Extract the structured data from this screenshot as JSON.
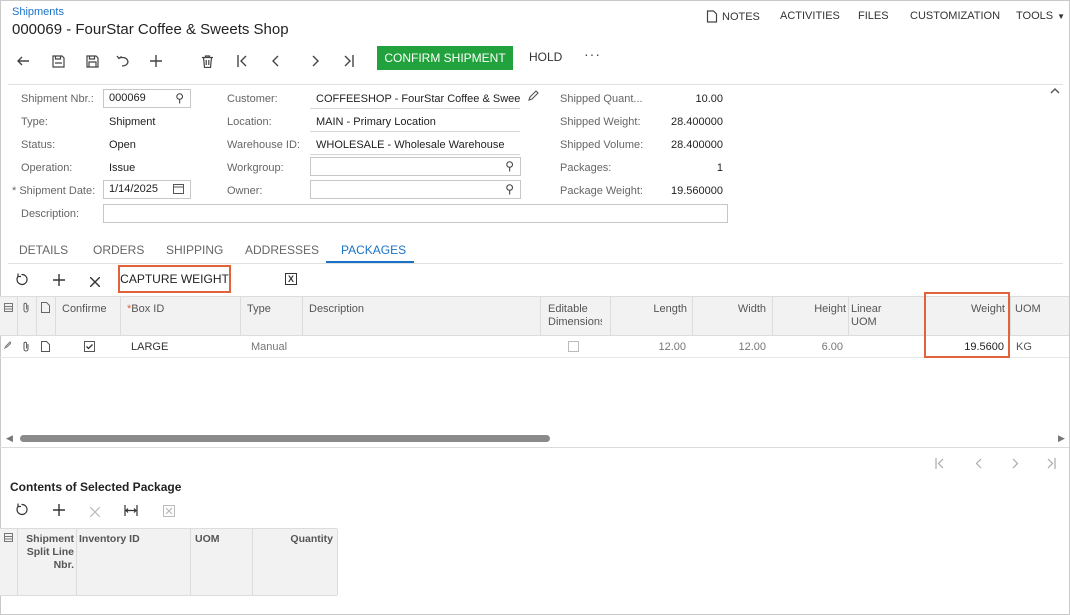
{
  "header": {
    "breadcrumb": "Shipments",
    "title": "000069 - FourStar Coffee & Sweets Shop",
    "menu": {
      "notes": "NOTES",
      "activities": "ACTIVITIES",
      "files": "FILES",
      "customization": "CUSTOMIZATION",
      "tools": "TOOLS"
    }
  },
  "toolbar": {
    "confirm_label": "CONFIRM SHIPMENT",
    "hold_label": "HOLD",
    "more_label": "···"
  },
  "form": {
    "shipment_nbr_label": "Shipment Nbr.:",
    "shipment_nbr": "000069",
    "type_label": "Type:",
    "type": "Shipment",
    "status_label": "Status:",
    "status": "Open",
    "operation_label": "Operation:",
    "operation": "Issue",
    "shipment_date_label": "Shipment Date:",
    "shipment_date": "1/14/2025",
    "description_label": "Description:",
    "description": "",
    "customer_label": "Customer:",
    "customer": "COFFEESHOP - FourStar Coffee & Swee",
    "location_label": "Location:",
    "location": "MAIN - Primary Location",
    "warehouse_label": "Warehouse ID:",
    "warehouse": "WHOLESALE - Wholesale Warehouse",
    "workgroup_label": "Workgroup:",
    "workgroup": "",
    "owner_label": "Owner:",
    "owner": "",
    "shipped_qty_label": "Shipped Quant...",
    "shipped_qty": "10.00",
    "shipped_weight_label": "Shipped Weight:",
    "shipped_weight": "28.400000",
    "shipped_volume_label": "Shipped Volume:",
    "shipped_volume": "28.400000",
    "packages_label": "Packages:",
    "packages": "1",
    "package_weight_label": "Package Weight:",
    "package_weight": "19.560000"
  },
  "tabs": [
    "DETAILS",
    "ORDERS",
    "SHIPPING",
    "ADDRESSES",
    "PACKAGES"
  ],
  "packages_grid": {
    "capture_weight_label": "CAPTURE WEIGHT",
    "columns": {
      "confirmed": "Confirmed",
      "box_id": "Box ID",
      "type": "Type",
      "description": "Description",
      "editable_dimensions": "Editable Dimensions",
      "length": "Length",
      "width": "Width",
      "height": "Height",
      "linear_uom": "Linear UOM",
      "weight": "Weight",
      "uom": "UOM"
    },
    "rows": [
      {
        "box_id": "LARGE",
        "type": "Manual",
        "description": "",
        "length": "12.00",
        "width": "12.00",
        "height": "6.00",
        "linear_uom": "",
        "weight": "19.5600",
        "uom": "KG"
      }
    ]
  },
  "contents": {
    "title": "Contents of Selected Package",
    "columns": {
      "shipment_split_line": "Shipment Split Line Nbr.",
      "inventory_id": "Inventory ID",
      "uom": "UOM",
      "quantity": "Quantity"
    }
  },
  "colors": {
    "accent": "#1a73c8",
    "confirm_green": "#22a23c",
    "highlight": "#e0633a"
  }
}
